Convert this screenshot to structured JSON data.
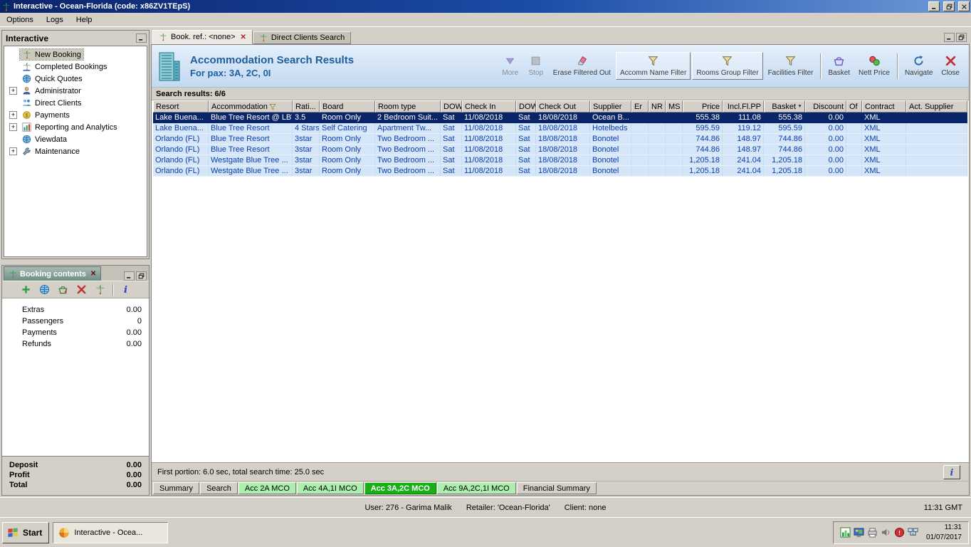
{
  "colors": {
    "selection": "#0a246a",
    "header_text": "#1d5f9e",
    "active_tab_green": "#17b117",
    "row_blue": "#d4e6f8"
  },
  "window": {
    "title": "Interactive - Ocean-Florida (code: x86ZV1TEpS)",
    "menu": [
      "Options",
      "Logs",
      "Help"
    ]
  },
  "sidebar": {
    "title": "Interactive",
    "items": [
      {
        "label": "New Booking",
        "icon": "palm-icon",
        "selected": true,
        "expandable": false
      },
      {
        "label": "Completed Bookings",
        "icon": "completed-bookings-icon",
        "expandable": false
      },
      {
        "label": "Quick Quotes",
        "icon": "quick-quotes-icon",
        "expandable": false
      },
      {
        "label": "Administrator",
        "icon": "administrator-icon",
        "expandable": true
      },
      {
        "label": "Direct Clients",
        "icon": "direct-clients-icon",
        "expandable": false
      },
      {
        "label": "Payments",
        "icon": "payments-icon",
        "expandable": true
      },
      {
        "label": "Reporting and Analytics",
        "icon": "reporting-icon",
        "expandable": true
      },
      {
        "label": "Viewdata",
        "icon": "viewdata-icon",
        "expandable": false
      },
      {
        "label": "Maintenance",
        "icon": "maintenance-icon",
        "expandable": true
      }
    ]
  },
  "booking_contents": {
    "tab_label": "Booking contents",
    "toolbar": [
      "add-icon",
      "web-icon",
      "basket-add-icon",
      "delete-icon",
      "palm-icon",
      "sep",
      "info-icon"
    ],
    "rows": [
      {
        "label": "Extras",
        "value": "0.00"
      },
      {
        "label": "Passengers",
        "value": "0"
      },
      {
        "label": "Payments",
        "value": "0.00"
      },
      {
        "label": "Refunds",
        "value": "0.00"
      }
    ],
    "totals": [
      {
        "label": "Deposit",
        "value": "0.00"
      },
      {
        "label": "Profit",
        "value": "0.00"
      },
      {
        "label": "Total",
        "value": "0.00"
      }
    ]
  },
  "main": {
    "tabs": [
      {
        "label": "Book. ref.: <none>",
        "active": true,
        "closable": true
      },
      {
        "label": "Direct Clients Search",
        "active": false,
        "closable": false
      }
    ],
    "header": {
      "title": "Accommodation Search Results",
      "subtitle": "For pax: 3A, 2C, 0I"
    },
    "toolbar": [
      {
        "label": "More",
        "icon": "more-icon",
        "disabled": true
      },
      {
        "label": "Stop",
        "icon": "stop-icon",
        "disabled": true
      },
      {
        "label": "Erase Filtered Out",
        "icon": "eraser-icon"
      },
      {
        "label": "Accomm Name Filter",
        "icon": "funnel-icon",
        "boxed": true
      },
      {
        "label": "Rooms Group Filter",
        "icon": "funnel-icon",
        "boxed": true
      },
      {
        "label": "Facilities Filter",
        "icon": "funnel-icon"
      },
      {
        "sep": true
      },
      {
        "label": "Basket",
        "icon": "basket-icon"
      },
      {
        "label": "Nett Price",
        "icon": "nett-price-icon"
      },
      {
        "sep": true
      },
      {
        "label": "Navigate",
        "icon": "navigate-icon"
      },
      {
        "label": "Close",
        "icon": "close-red-icon"
      }
    ],
    "results_label": "Search results: 6/6",
    "table": {
      "columns": [
        "Resort",
        "Accommodation",
        "Rati...",
        "Board",
        "Room type",
        "DOW",
        "Check In",
        "DOW",
        "Check Out",
        "Supplier",
        "Er",
        "NR",
        "MS",
        "Price",
        "Incl.Fl.PP",
        "Basket",
        "Discount",
        "Of",
        "Contract",
        "Act. Supplier"
      ],
      "filtered_column": "Accommodation",
      "sorted_column": "Basket",
      "selected_row": 0,
      "rows": [
        [
          "Lake Buena...",
          "Blue Tree Resort @ LBV",
          "3.5",
          "Room Only",
          "2 Bedroom Suit...",
          "Sat",
          "11/08/2018",
          "Sat",
          "18/08/2018",
          "Ocean B...",
          "",
          "",
          "",
          "555.38",
          "111.08",
          "555.38",
          "0.00",
          "",
          "XML",
          ""
        ],
        [
          "Lake Buena...",
          "Blue Tree Resort",
          "4 Stars",
          "Self Catering",
          "Apartment Tw...",
          "Sat",
          "11/08/2018",
          "Sat",
          "18/08/2018",
          "Hotelbeds",
          "",
          "",
          "",
          "595.59",
          "119.12",
          "595.59",
          "0.00",
          "",
          "XML",
          ""
        ],
        [
          "Orlando (FL)",
          "Blue Tree Resort",
          "3star",
          "Room Only",
          "Two Bedroom ...",
          "Sat",
          "11/08/2018",
          "Sat",
          "18/08/2018",
          "Bonotel",
          "",
          "",
          "",
          "744.86",
          "148.97",
          "744.86",
          "0.00",
          "",
          "XML",
          ""
        ],
        [
          "Orlando (FL)",
          "Blue Tree Resort",
          "3star",
          "Room Only",
          "Two Bedroom ...",
          "Sat",
          "11/08/2018",
          "Sat",
          "18/08/2018",
          "Bonotel",
          "",
          "",
          "",
          "744.86",
          "148.97",
          "744.86",
          "0.00",
          "",
          "XML",
          ""
        ],
        [
          "Orlando (FL)",
          "Westgate Blue Tree ...",
          "3star",
          "Room Only",
          "Two Bedroom ...",
          "Sat",
          "11/08/2018",
          "Sat",
          "18/08/2018",
          "Bonotel",
          "",
          "",
          "",
          "1,205.18",
          "241.04",
          "1,205.18",
          "0.00",
          "",
          "XML",
          ""
        ],
        [
          "Orlando (FL)",
          "Westgate Blue Tree ...",
          "3star",
          "Room Only",
          "Two Bedroom ...",
          "Sat",
          "11/08/2018",
          "Sat",
          "18/08/2018",
          "Bonotel",
          "",
          "",
          "",
          "1,205.18",
          "241.04",
          "1,205.18",
          "0.00",
          "",
          "XML",
          ""
        ]
      ]
    },
    "status_text": "First portion: 6.0 sec, total search time: 25.0 sec",
    "bottom_tabs": [
      {
        "label": "Summary",
        "style": "plain"
      },
      {
        "label": "Search",
        "style": "plain"
      },
      {
        "label": "Acc 2A MCO",
        "style": "green"
      },
      {
        "label": "Acc 4A,1I MCO",
        "style": "green"
      },
      {
        "label": "Acc 3A,2C MCO",
        "style": "active"
      },
      {
        "label": "Acc 9A,2C,1I MCO",
        "style": "green"
      },
      {
        "label": "Financial Summary",
        "style": "plain"
      }
    ]
  },
  "status_bar": {
    "segments": [
      "User: 276 - Garima Malik",
      "Retailer: 'Ocean-Florida'",
      "Client: none"
    ],
    "time": "11:31 GMT"
  },
  "taskbar": {
    "start_label": "Start",
    "task_label": "Interactive - Ocea...",
    "tray_icons": [
      "chart-tray-icon",
      "display-tray-icon",
      "printer-tray-icon",
      "volume-tray-icon",
      "alert-tray-icon",
      "network-tray-icon"
    ],
    "clock": {
      "time": "11:31",
      "date": "01/07/2017"
    }
  }
}
